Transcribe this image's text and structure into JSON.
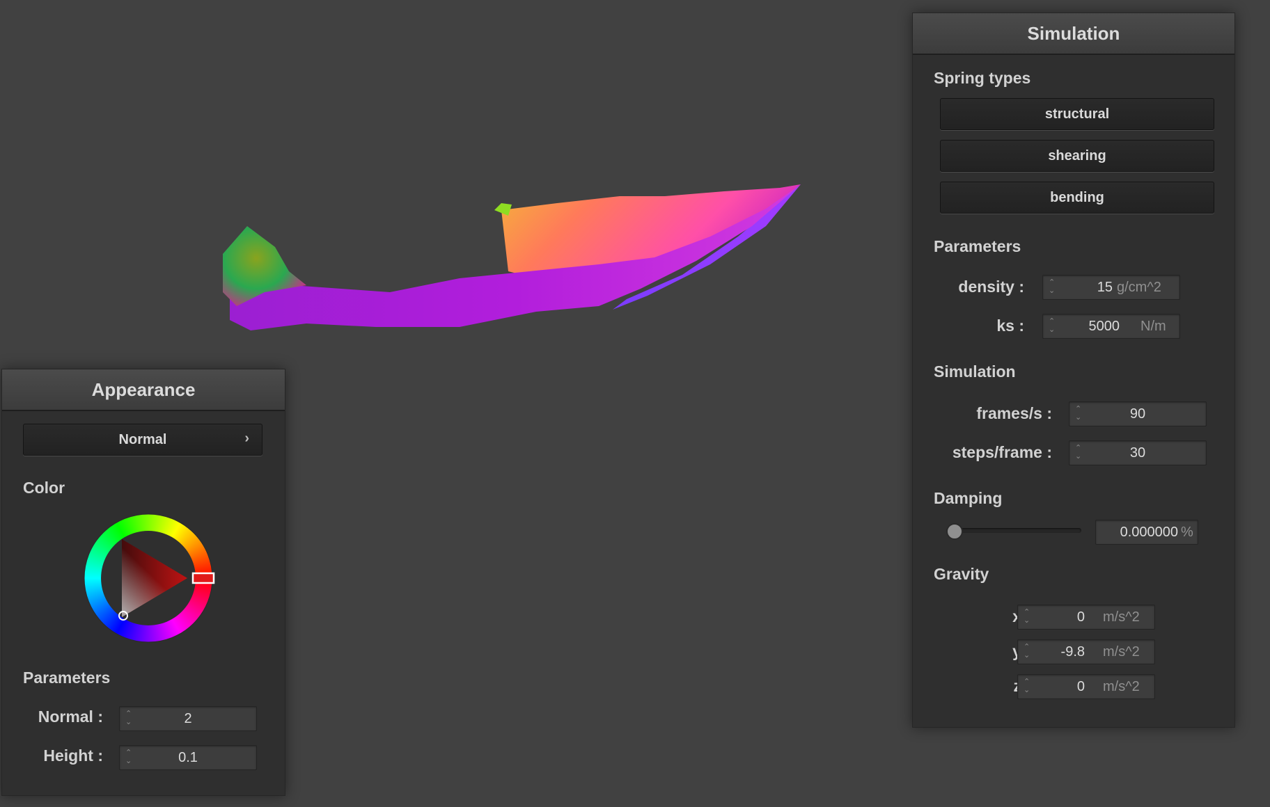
{
  "appearance": {
    "title": "Appearance",
    "mode_value": "Normal",
    "color_label": "Color",
    "parameters_label": "Parameters",
    "normal_label": "Normal :",
    "normal_value": "2",
    "height_label": "Height :",
    "height_value": "0.1",
    "selected_color": "#ff1a1a"
  },
  "simulation": {
    "title": "Simulation",
    "spring_types_label": "Spring types",
    "springs": [
      "structural",
      "shearing",
      "bending"
    ],
    "parameters_label": "Parameters",
    "density_label": "density :",
    "density_value": "15",
    "density_unit": "g/cm^2",
    "ks_label": "ks :",
    "ks_value": "5000",
    "ks_unit": "N/m",
    "simulation_label": "Simulation",
    "fps_label": "frames/s :",
    "fps_value": "90",
    "steps_label": "steps/frame :",
    "steps_value": "30",
    "damping_label": "Damping",
    "damping_value": "0.000000",
    "damping_unit": "%",
    "damping_fraction": 0,
    "gravity_label": "Gravity",
    "gx_label": "x :",
    "gx_value": "0",
    "gy_label": "y :",
    "gy_value": "-9.8",
    "gz_label": "z :",
    "gz_value": "0",
    "gravity_unit": "m/s^2"
  },
  "colors": {
    "background": "#414141",
    "panel": "#2f2f2f",
    "cloth_magenta": "#c41fd6",
    "cloth_orange": "#ff8a4a",
    "cloth_green": "#6aa81f"
  }
}
